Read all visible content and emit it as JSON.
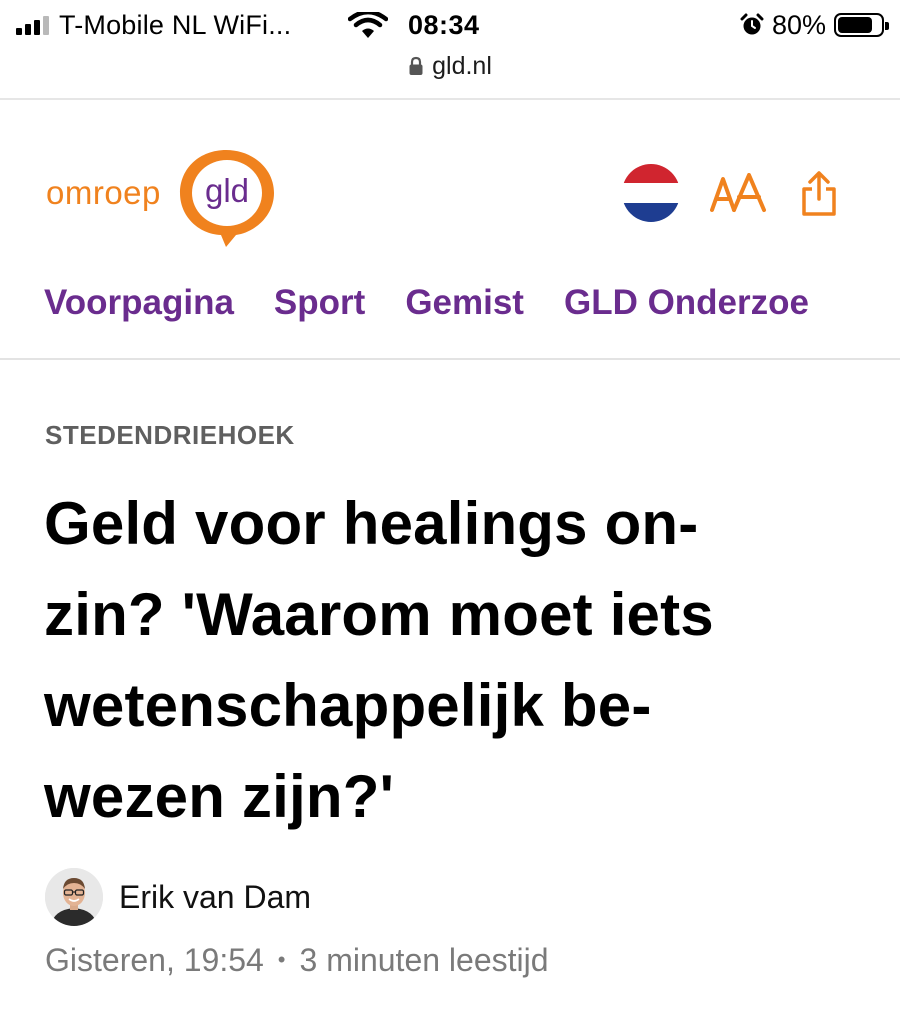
{
  "status_bar": {
    "carrier": "T-Mobile  NL WiFi...",
    "time": "08:34",
    "battery_percent": "80%",
    "battery_level": 0.8,
    "signal_bars_active": 3,
    "signal_bars_total": 4,
    "icons": [
      "signal-icon",
      "wifi-icon",
      "alarm-icon",
      "battery-icon"
    ]
  },
  "browser": {
    "url": "gld.nl",
    "icons": [
      "lock-icon"
    ]
  },
  "header": {
    "logo_text": "omroep gld",
    "icons": [
      "dutch-flag-icon",
      "text-size-icon",
      "share-icon"
    ]
  },
  "nav": {
    "items": [
      {
        "label": "Voorpagina"
      },
      {
        "label": "Sport"
      },
      {
        "label": "Gemist"
      },
      {
        "label": "GLD Onderzoe"
      }
    ]
  },
  "article": {
    "category": "STEDENDRIEHOEK",
    "headline_lines": [
      "Geld voor healings on-",
      "zin? 'Waarom moet iets",
      "wetenschappelijk be-",
      "wezen zijn?'"
    ],
    "author": "Erik van Dam",
    "date": "Gisteren, 19:54",
    "separator": "•",
    "reading_time": "3 minuten leestijd"
  },
  "colors": {
    "brand_orange": "#f0821e",
    "brand_purple": "#6a2c8e",
    "meta_gray": "#7a7a7a",
    "category_gray": "#5f5f5f"
  }
}
